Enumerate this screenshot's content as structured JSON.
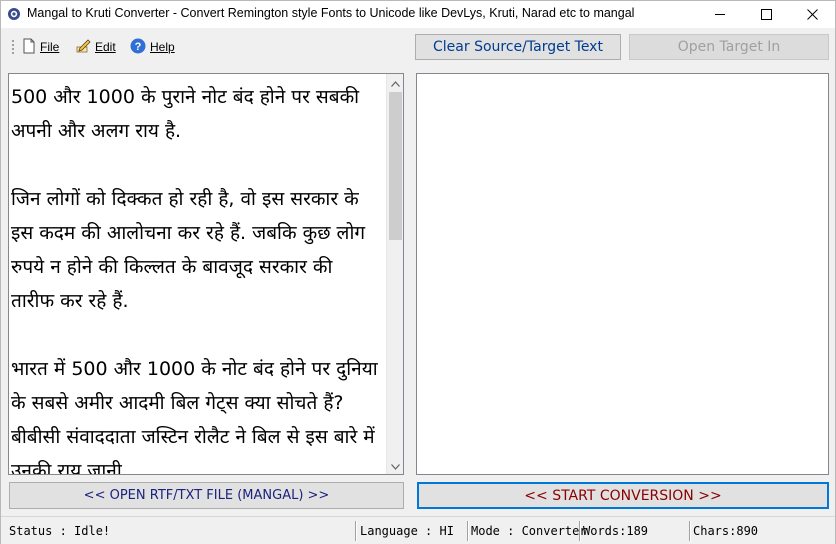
{
  "window": {
    "title": "Mangal to Kruti Converter - Convert Remington style Fonts to Unicode like DevLys, Kruti, Narad etc to mangal"
  },
  "menu": {
    "file": "File",
    "edit": "Edit",
    "help": "Help"
  },
  "toolbar": {
    "clear_label": "Clear Source/Target Text",
    "open_target_label": "Open Target In"
  },
  "source": {
    "text": "500 और 1000 के पुराने नोट बंद होने पर सबकी अपनी और अलग राय है.\n\nजिन लोगों को दिक्कत हो रही है, वो इस सरकार के इस कदम की आलोचना कर रहे हैं. जबकि कुछ लोग रुपये न होने की किल्लत के बावजूद सरकार की तारीफ कर रहे हैं.\n\nभारत में 500 और 1000 के नोट बंद होने पर दुनिया के सबसे अमीर आदमी बिल गेट्स क्या सोचते हैं? बीबीसी संवाददाता जस्टिन रोलैट ने बिल से इस बारे में उनकी राय जानी"
  },
  "target": {
    "text": ""
  },
  "actions": {
    "open_file_label": "<< OPEN RTF/TXT FILE (MANGAL) >>",
    "start_label": "<< START CONVERSION >>"
  },
  "status": {
    "status": "Status :  Idle!",
    "language": "Language : HI",
    "mode": "Mode : Converter",
    "words": "Words:189",
    "chars": "Chars:890"
  },
  "colors": {
    "title_bg": "#ffffff",
    "window_bg": "#f0f0f0",
    "clear_text": "#003c8f",
    "open_file_text": "#1a237e",
    "start_text": "#8b0000",
    "start_border": "#0078d7"
  },
  "icons": {
    "app": "app-gear-icon",
    "file": "file-icon",
    "edit": "edit-pencil-icon",
    "help": "help-question-icon"
  }
}
